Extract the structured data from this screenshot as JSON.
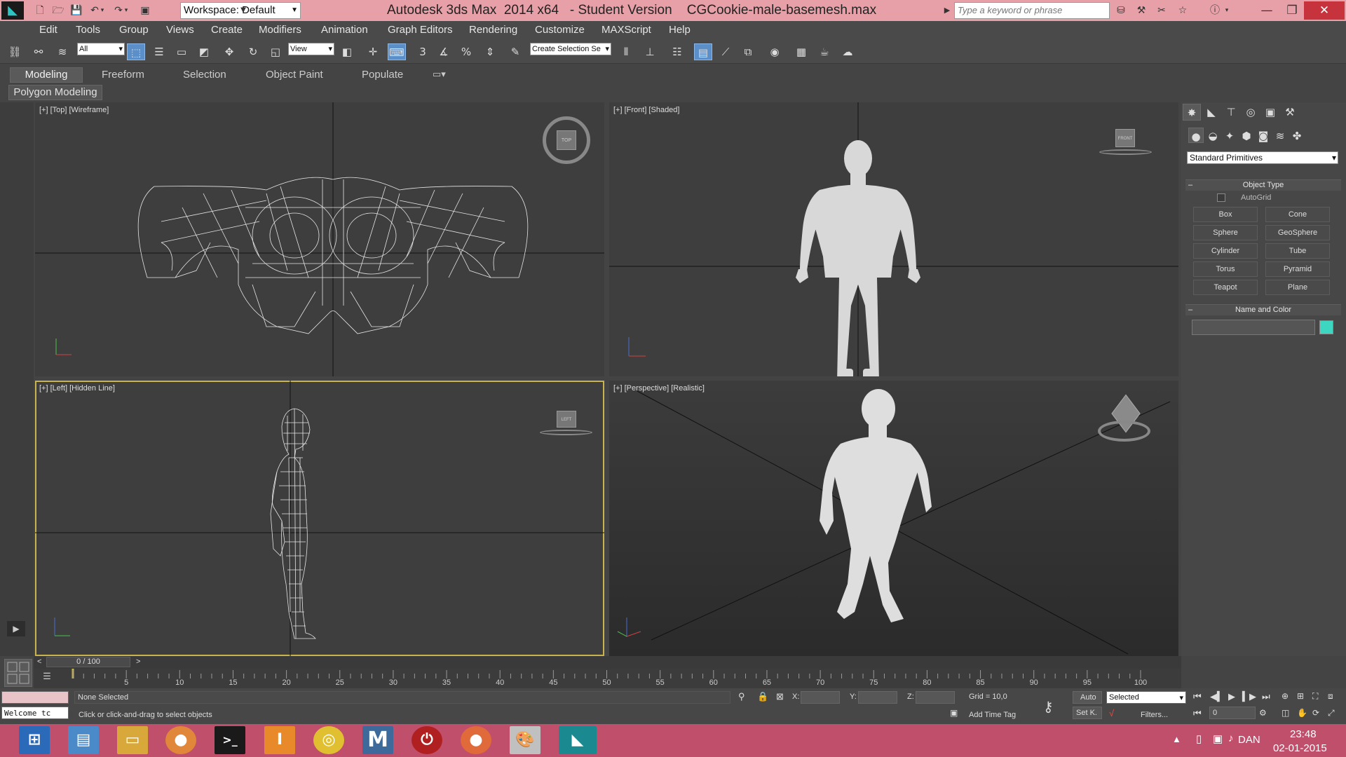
{
  "window": {
    "title": "Autodesk 3ds Max  2014 x64   - Student Version    CGCookie-male-basemesh.max",
    "workspace": "Workspace: Default",
    "search_placeholder": "Type a keyword or phrase"
  },
  "menu": [
    "Edit",
    "Tools",
    "Group",
    "Views",
    "Create",
    "Modifiers",
    "Animation",
    "Graph Editors",
    "Rendering",
    "Customize",
    "MAXScript",
    "Help"
  ],
  "toolbar": {
    "selection_filter": "All",
    "ref_coord": "View",
    "named_selection": "Create Selection Se"
  },
  "ribbon": {
    "tabs": [
      "Modeling",
      "Freeform",
      "Selection",
      "Object Paint",
      "Populate"
    ],
    "panel": "Polygon Modeling"
  },
  "viewports": {
    "top": "[+] [Top] [Wireframe]",
    "front": "[+] [Front] [Shaded]",
    "left": "[+] [Left] [Hidden Line]",
    "perspective": "[+] [Perspective] [Realistic]",
    "cube_top": "TOP",
    "cube_front": "FRONT",
    "cube_left": "LEFT"
  },
  "command_panel": {
    "category": "Standard Primitives",
    "object_type_title": "Object Type",
    "autogrid": "AutoGrid",
    "buttons": [
      "Box",
      "Cone",
      "Sphere",
      "GeoSphere",
      "Cylinder",
      "Tube",
      "Torus",
      "Pyramid",
      "Teapot",
      "Plane"
    ],
    "name_color_title": "Name and Color",
    "object_color": "#3dd6c0"
  },
  "timeline": {
    "frame_display": "0 / 100",
    "ticks": [
      "5",
      "10",
      "15",
      "20",
      "25",
      "30",
      "35",
      "40",
      "45",
      "50",
      "55",
      "60",
      "65",
      "70",
      "75",
      "80",
      "85",
      "90",
      "95",
      "100"
    ]
  },
  "status": {
    "maxscript": "Welcome tc",
    "selection": "None Selected",
    "prompt": "Click or click-and-drag to select objects",
    "x_label": "X:",
    "y_label": "Y:",
    "z_label": "Z:",
    "grid": "Grid = 10,0",
    "add_time_tag": "Add Time Tag",
    "auto_key": "Auto",
    "set_key": "Set K.",
    "key_filter": "Selected",
    "filters": "Filters...",
    "current_frame": "0"
  },
  "taskbar": {
    "language": "DAN",
    "time": "23:48",
    "date": "02-01-2015"
  }
}
